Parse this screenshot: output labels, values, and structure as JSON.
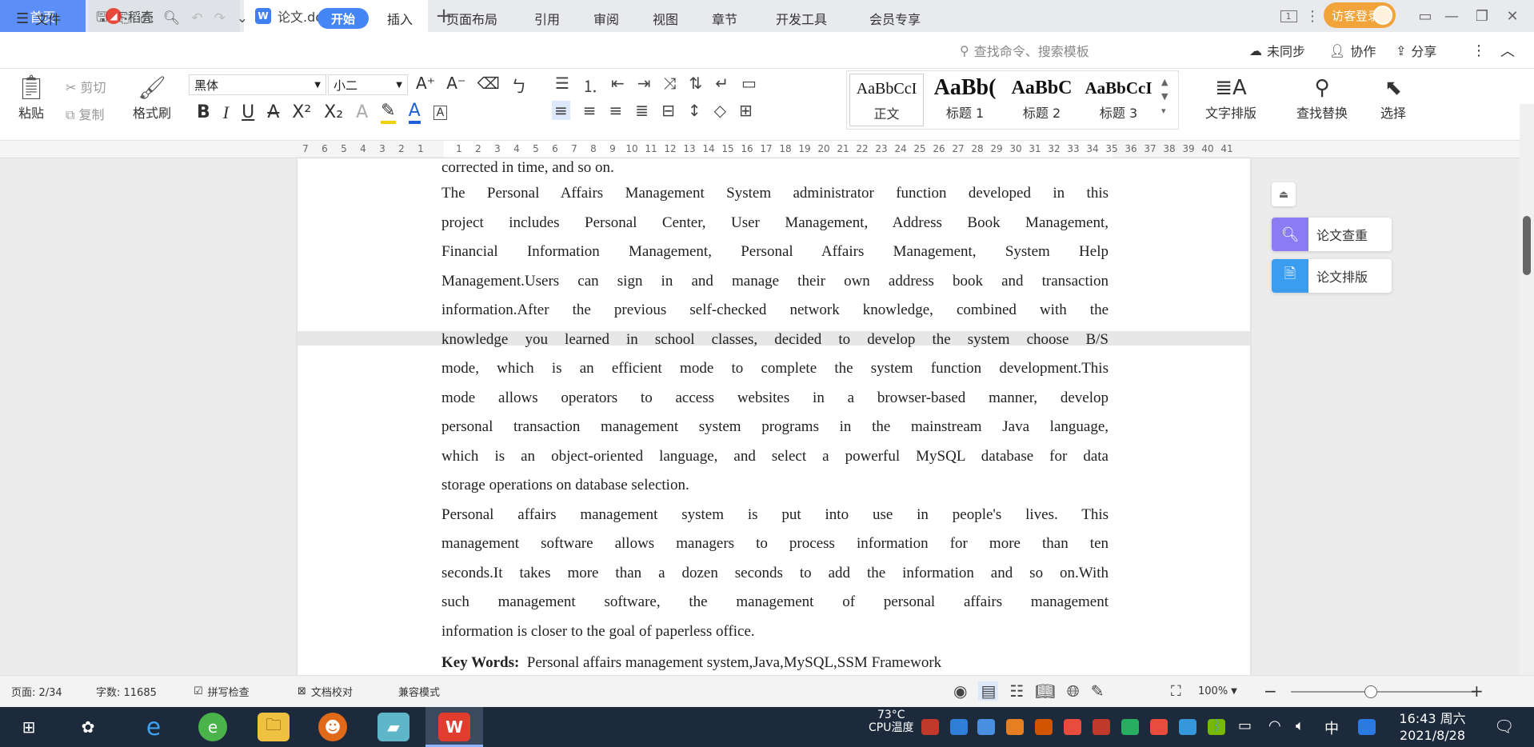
{
  "tabs": {
    "home": "首页",
    "daoke": "稻壳",
    "doc": "论文.doc",
    "add": "+"
  },
  "window": {
    "login": "访客登录",
    "page_indicator": "1"
  },
  "menu": {
    "file": "文件",
    "items": [
      "开始",
      "插入",
      "页面布局",
      "引用",
      "审阅",
      "视图",
      "章节",
      "开发工具",
      "会员专享"
    ],
    "search_placeholder": "查找命令、搜索模板",
    "sync": "未同步",
    "collab": "协作",
    "share": "分享"
  },
  "ribbon": {
    "paste": "粘贴",
    "cut": "剪切",
    "copy": "复制",
    "format_painter": "格式刷",
    "font_name": "黑体",
    "font_size": "小二",
    "styles": [
      {
        "preview": "AaBbCcI",
        "name": "正文"
      },
      {
        "preview": "AaBb(",
        "name": "标题 1"
      },
      {
        "preview": "AaBbC",
        "name": "标题 2"
      },
      {
        "preview": "AaBbCcI",
        "name": "标题 3"
      }
    ],
    "text_layout": "文字排版",
    "find_replace": "查找替换",
    "select": "选择"
  },
  "ruler": {
    "left_ticks": [
      "7",
      "6",
      "5",
      "4",
      "3",
      "2",
      "1"
    ],
    "right_ticks": [
      "1",
      "2",
      "3",
      "4",
      "5",
      "6",
      "7",
      "8",
      "9",
      "10",
      "11",
      "12",
      "13",
      "14",
      "15",
      "16",
      "17",
      "18",
      "19",
      "20",
      "21",
      "22",
      "23",
      "24",
      "25",
      "26",
      "27",
      "28",
      "29",
      "30",
      "31",
      "32",
      "33",
      "34",
      "35",
      "36",
      "37",
      "38",
      "39",
      "40",
      "41"
    ]
  },
  "document": {
    "lines": [
      "corrected in time, and so on.",
      "The Personal Affairs Management System administrator function developed in this",
      "project includes Personal Center, User Management, Address Book Management,",
      "Financial Information Management, Personal Affairs Management, System Help",
      "Management.Users can sign in and manage their own address book and transaction",
      "information.After the previous self-checked network knowledge, combined with the",
      "knowledge you learned in school classes, decided to develop the system choose B/S",
      "mode, which is an efficient mode to complete the system function development.This",
      "mode allows operators to access websites in a browser-based manner, develop",
      "personal transaction management system programs in the mainstream Java language,",
      "which is an object-oriented language, and select a powerful MySQL database for data",
      "storage operations on database selection.",
      "Personal affairs management system is put into use in people's lives. This",
      "management software allows managers to process information for more than ten",
      "seconds.It takes more than a dozen seconds to add the information and so on.With",
      "such management software, the management of personal affairs management",
      "information is closer to the goal of paperless office."
    ],
    "keywords_label": "Key Words:",
    "keywords_text": "Personal affairs management system,Java,MySQL,SSM Framework"
  },
  "side_panel": {
    "check": "论文查重",
    "layout": "论文排版"
  },
  "status": {
    "page": "页面: 2/34",
    "words": "字数: 11685",
    "spell": "拼写检查",
    "proof": "文档校对",
    "compat": "兼容模式",
    "zoom": "100%"
  },
  "taskbar": {
    "temp": "73°C",
    "cpu": "CPU温度",
    "ime": "中",
    "time": "16:43 周六",
    "date": "2021/8/28"
  },
  "colors": {
    "accent": "#4486f6",
    "login": "#f2a33a",
    "wps_red": "#e23c2e"
  }
}
